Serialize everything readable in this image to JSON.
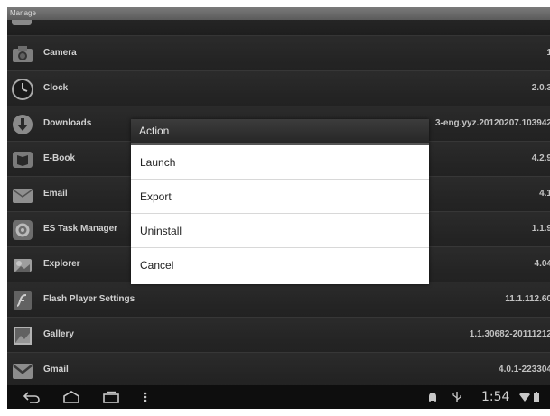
{
  "titlebar": {
    "title": "Manage"
  },
  "apps": [
    {
      "name": "Camera",
      "version": "1",
      "icon": "camera-icon"
    },
    {
      "name": "Clock",
      "version": "2.0.3",
      "icon": "clock-icon"
    },
    {
      "name": "Downloads",
      "version": "3-eng.yyz.20120207.103942",
      "icon": "download-icon"
    },
    {
      "name": "E-Book",
      "version": "4.2.9",
      "icon": "book-icon"
    },
    {
      "name": "Email",
      "version": "4.1",
      "icon": "email-icon"
    },
    {
      "name": "ES Task Manager",
      "version": "1.1.9",
      "icon": "task-manager-icon"
    },
    {
      "name": "Explorer",
      "version": "4.04",
      "icon": "explorer-icon"
    },
    {
      "name": "Flash Player Settings",
      "version": "11.1.112.60",
      "icon": "flash-icon"
    },
    {
      "name": "Gallery",
      "version": "1.1.30682-20111212",
      "icon": "gallery-icon"
    },
    {
      "name": "Gmail",
      "version": "4.0.1-223304",
      "icon": "gmail-icon"
    }
  ],
  "dialog": {
    "title": "Action",
    "items": [
      "Launch",
      "Export",
      "Uninstall",
      "Cancel"
    ]
  },
  "status": {
    "time": "1:54"
  },
  "colors": {
    "background": "#2b2b2b",
    "dialog": "#ffffff",
    "navbar": "#0e0e0e"
  }
}
